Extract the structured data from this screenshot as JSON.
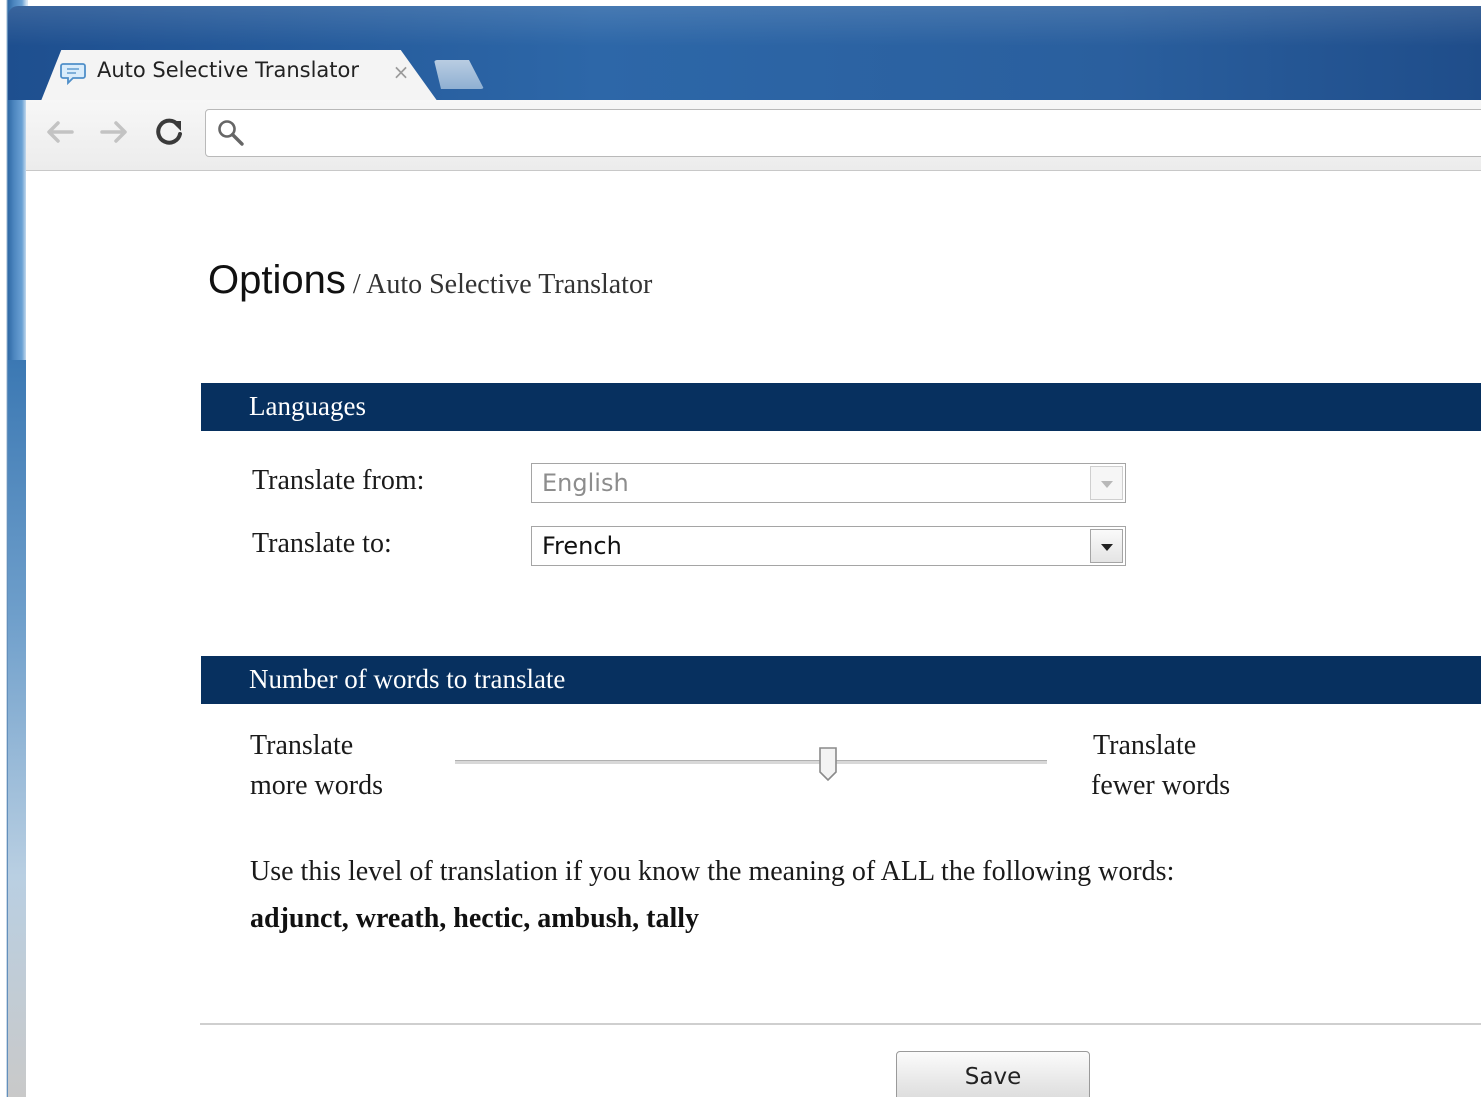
{
  "browser": {
    "tab_title": "Auto Selective Translator",
    "tab_close_glyph": "×",
    "tab_icon": "speech-bubble-icon",
    "omnibox_icon": "search-icon",
    "omnibox_value": ""
  },
  "page": {
    "heading_main": "Options",
    "heading_sub": " / Auto Selective Translator"
  },
  "languages": {
    "section_title": "Languages",
    "from_label": "Translate from:",
    "from_value": "English",
    "from_disabled": true,
    "to_label": "Translate to:",
    "to_value": "French"
  },
  "words": {
    "section_title": "Number of words to translate",
    "left_label_line1": "Translate",
    "left_label_line2": "more words",
    "right_label_line1": "Translate",
    "right_label_line2": "fewer words",
    "slider_fraction": 0.63,
    "info": "Use this level of translation if you know the meaning of ALL the following words:",
    "example_words": "adjunct, wreath, hectic, ambush, tally"
  },
  "footer": {
    "save_label": "Save"
  },
  "colors": {
    "section_bar": "#07305f",
    "titlebar": "#2d67a8"
  }
}
